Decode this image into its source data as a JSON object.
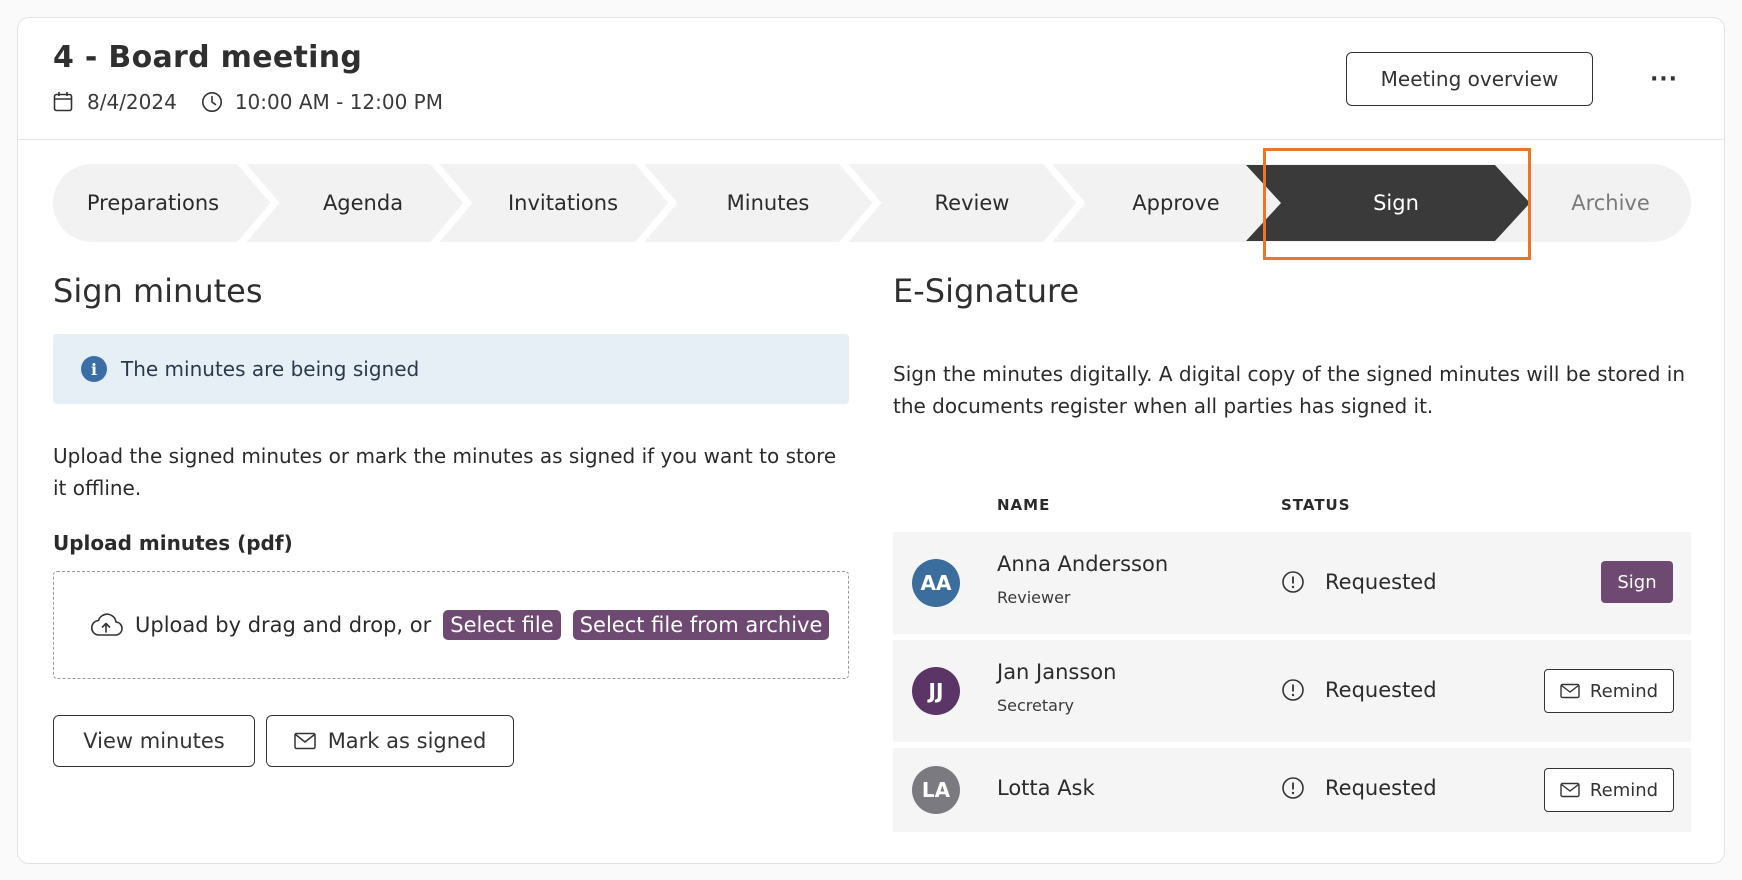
{
  "header": {
    "title": "4 - Board meeting",
    "date": "8/4/2024",
    "time": "10:00 AM - 12:00 PM",
    "overview_button": "Meeting overview",
    "more_button": "···"
  },
  "stepper": {
    "steps": [
      {
        "label": "Preparations",
        "state": "done"
      },
      {
        "label": "Agenda",
        "state": "done"
      },
      {
        "label": "Invitations",
        "state": "done"
      },
      {
        "label": "Minutes",
        "state": "done"
      },
      {
        "label": "Review",
        "state": "done"
      },
      {
        "label": "Approve",
        "state": "done"
      },
      {
        "label": "Sign",
        "state": "active"
      },
      {
        "label": "Archive",
        "state": "upcoming"
      }
    ],
    "colors": {
      "track": "#f2f2f2",
      "active": "#3a3a3a",
      "highlight": "#e8772e"
    }
  },
  "left": {
    "heading": "Sign minutes",
    "info": "The minutes are being signed",
    "description": "Upload the signed minutes or mark the minutes as signed if you want to store it offline.",
    "upload_label": "Upload minutes (pdf)",
    "dropzone_text": "Upload by drag and drop, or",
    "select_file": "Select file",
    "select_archive": "Select file from archive",
    "view_minutes": "View minutes",
    "mark_signed": "Mark as signed"
  },
  "right": {
    "heading": "E-Signature",
    "description": "Sign the minutes digitally. A digital copy of the signed minutes will be stored in the documents register when all parties has signed it.",
    "columns": {
      "name": "NAME",
      "status": "STATUS"
    },
    "signers": [
      {
        "initials": "AA",
        "name": "Anna Andersson",
        "role": "Reviewer",
        "status": "Requested",
        "action": "Sign",
        "avatar_color": "#3b6e9c"
      },
      {
        "initials": "JJ",
        "name": "Jan Jansson",
        "role": "Secretary",
        "status": "Requested",
        "action": "Remind",
        "avatar_color": "#5b3566"
      },
      {
        "initials": "LA",
        "name": "Lotta Ask",
        "role": "",
        "status": "Requested",
        "action": "Remind",
        "avatar_color": "#7a7a80"
      }
    ]
  },
  "brand": {
    "accent": "#6e4a73",
    "info_bg": "#e6eef6"
  }
}
